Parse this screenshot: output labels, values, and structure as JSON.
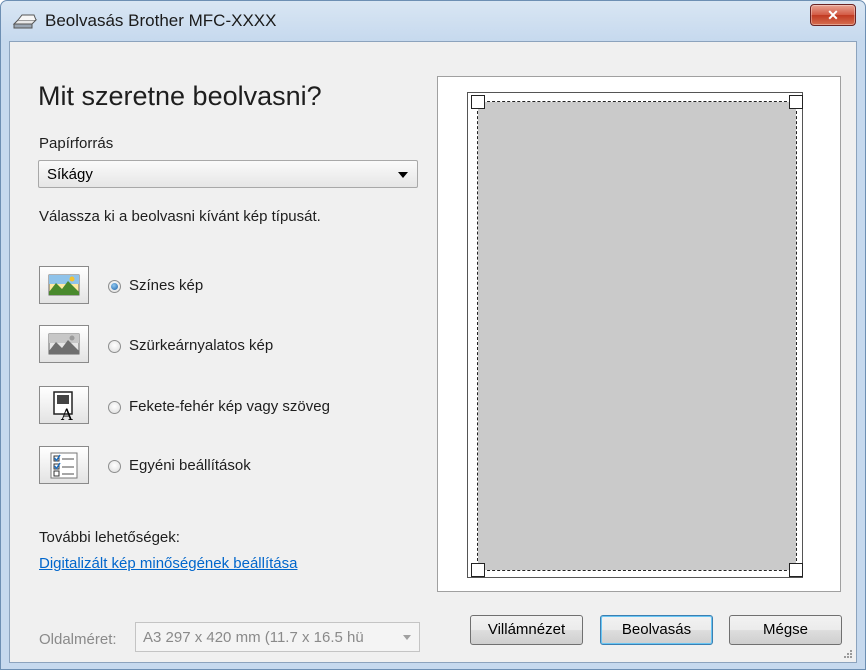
{
  "window": {
    "title": "Beolvasás Brother MFC-XXXX",
    "close_label": "✕"
  },
  "main": {
    "heading": "Mit szeretne beolvasni?",
    "paper_source_label": "Papírforrás",
    "paper_source_value": "Síkágy",
    "prompt": "Válassza ki a beolvasni kívánt kép típusát.",
    "options": [
      {
        "label": "Színes kép",
        "icon": "color-picture-icon",
        "selected": true
      },
      {
        "label": "Szürkeárnyalatos kép",
        "icon": "grayscale-picture-icon",
        "selected": false
      },
      {
        "label": "Fekete-fehér kép vagy szöveg",
        "icon": "black-white-text-icon",
        "selected": false
      },
      {
        "label": "Egyéni beállítások",
        "icon": "custom-settings-icon",
        "selected": false
      }
    ],
    "more_options_label": "További lehetőségek:",
    "quality_link": "Digitalizált kép minőségének beállítása",
    "page_size_label": "Oldalméret:",
    "page_size_value": "A3 297 x 420 mm (11.7 x 16.5 hü"
  },
  "buttons": {
    "preview": "Villámnézet",
    "scan": "Beolvasás",
    "cancel": "Mégse"
  },
  "colors": {
    "link": "#0066cc",
    "scan_area": "#cacaca",
    "close_button": "#c13a22"
  }
}
